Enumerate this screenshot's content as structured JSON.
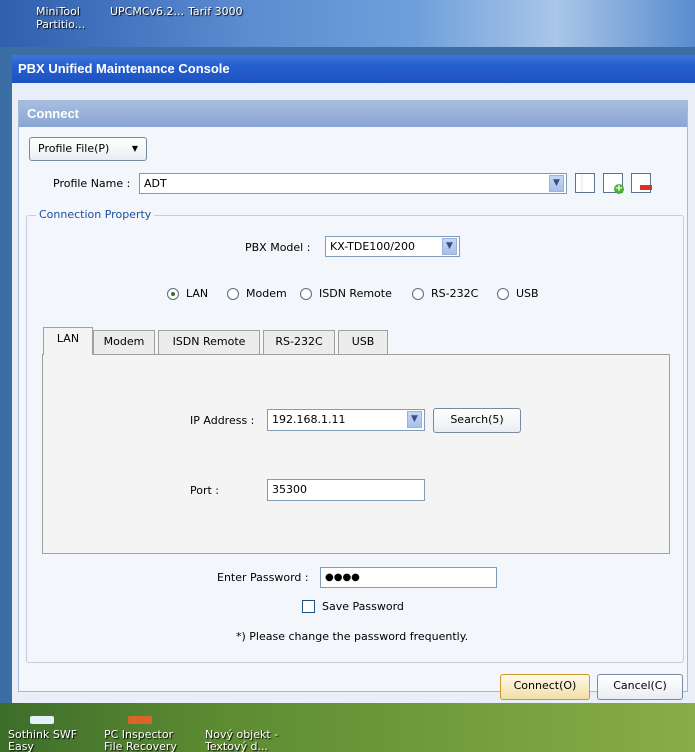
{
  "desktop_top": {
    "items": [
      {
        "label": "MiniTool\nPartitio..."
      },
      {
        "label": "UPCMCv6.2..."
      },
      {
        "label": "Tarif 3000"
      }
    ]
  },
  "window": {
    "title": "PBX Unified Maintenance Console"
  },
  "panel": {
    "title": "Connect"
  },
  "profile": {
    "file_button": "Profile File(P)",
    "name_label": "Profile Name :",
    "name_value": "ADT"
  },
  "connection": {
    "group_label": "Connection Property",
    "pbx_model_label": "PBX Model :",
    "pbx_model_value": "KX-TDE100/200",
    "radio_options": [
      "LAN",
      "Modem",
      "ISDN Remote",
      "RS-232C",
      "USB"
    ],
    "selected": "LAN",
    "tabs": [
      "LAN",
      "Modem",
      "ISDN Remote",
      "RS-232C",
      "USB"
    ],
    "ip_label": "IP Address :",
    "ip_value": "192.168.1.11",
    "search_button": "Search(5)",
    "port_label": "Port :",
    "port_value": "35300"
  },
  "password": {
    "label": "Enter Password :",
    "value": "●●●●",
    "save_label": "Save Password",
    "note": "*) Please change the password frequently."
  },
  "buttons": {
    "connect": "Connect(O)",
    "cancel": "Cancel(C)"
  },
  "desktop_bottom": {
    "items": [
      {
        "label": "Sothink SWF\nEasy"
      },
      {
        "label": "PC Inspector\nFile Recovery"
      },
      {
        "label": "Nový objekt -\nTextový d..."
      }
    ]
  },
  "colors": {
    "titlebar": "#245fcf",
    "panel_head": "#8aa5d4",
    "radio_on": "#3b6e2e"
  }
}
